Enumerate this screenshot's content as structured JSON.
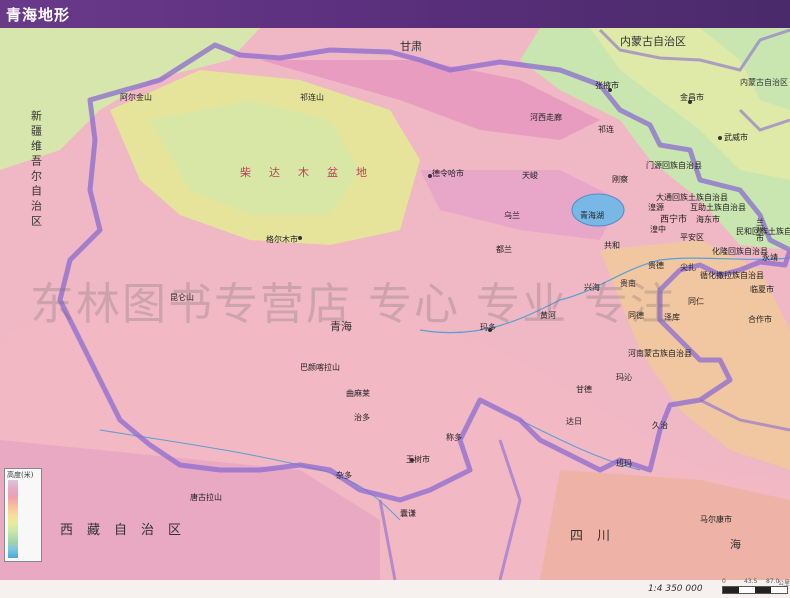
{
  "header": {
    "title": "青海地形",
    "title_color": "#ffffff",
    "banner_color": "#5a2f7c"
  },
  "scale": {
    "ratio": "1:4 350 000",
    "ticks": [
      "0",
      "43.5",
      "87.0"
    ],
    "unit": "公里"
  },
  "legend": {
    "title": "高度(米)"
  },
  "watermark": "东林图书专营店 专心 专业 专注",
  "provinces": {
    "gansu": "甘肃",
    "xinjiang": "新疆维吾尔自治区",
    "neimenggu": "内蒙古自治区",
    "neimenggu_side": "内蒙古自治区",
    "xizang": "西藏自治区",
    "sichuan": "四川",
    "qinghai_hai": "海"
  },
  "cities": {
    "zhangye": "张掖市",
    "jinchang": "金昌市",
    "wuwei": "武威市",
    "jiuquan": "祁连",
    "menyuan": "门源回族自治县",
    "delingha": "德令哈市",
    "tianjun": "天峻",
    "gangcha": "刚察",
    "datong": "大通回族土族自治县",
    "huzhu": "互助土族自治县",
    "xining": "西宁市",
    "haidong": "海东市",
    "huangyuan": "湟源",
    "huangzhong": "湟中",
    "pingan": "平安区",
    "ledu": "化隆回族自治县",
    "minhe": "民和回族土族自治县",
    "lanzhou": "兰州市",
    "yongjing": "永靖",
    "golmud": "格尔木市",
    "wulan": "乌兰",
    "dulan": "都兰",
    "gonghe": "共和",
    "guide": "贵德",
    "jianzha": "尖扎",
    "xunhua": "循化撒拉族自治县",
    "linxia": "临夏市",
    "hezuo": "合作市",
    "tongren": "同仁",
    "zeku": "泽库",
    "henan": "河南蒙古族自治县",
    "tongde": "同德",
    "xinghai": "兴海",
    "guinan": "贵南",
    "maduo": "玛多",
    "qumalai": "曲麻莱",
    "zhiduo": "治多",
    "zaduo": "杂多",
    "yushu": "玉树市",
    "chengduo": "称多",
    "nangqian": "囊谦",
    "gande": "甘德",
    "dari": "达日",
    "jiuzhi": "久治",
    "banma": "班玛",
    "maqin": "玛沁",
    "maerkang": "马尔康市",
    "qinghai_province": "青海"
  },
  "features": {
    "qaidam": "柴达木盆地",
    "qilian": "祁连山",
    "kunlun": "昆仑山",
    "tanggula": "唐古拉山",
    "bayankala": "巴颜喀拉山",
    "aerjin": "阿尔金山",
    "qinghaihu": "青海湖",
    "huanghe": "黄河",
    "hexi": "河西走廊"
  },
  "colors": {
    "plateau_pink": "#ecaab8",
    "high_pink": "#f2b3c6",
    "basin_yellow": "#e6e49a",
    "lowland_green": "#c9e6b0",
    "border_purple": "#8b6bd0",
    "lake_blue": "#79b8e6"
  }
}
